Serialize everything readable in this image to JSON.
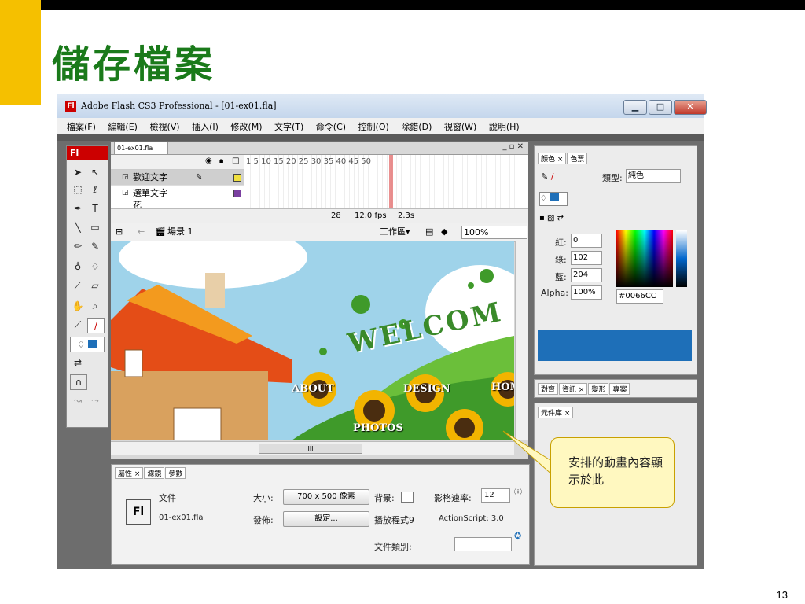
{
  "slide": {
    "title": "儲存檔案",
    "page_number": "13"
  },
  "window": {
    "title": "Adobe Flash CS3 Professional - [01-ex01.fla]",
    "min": "▁",
    "max": "□",
    "close": "✕"
  },
  "menu": [
    "檔案(F)",
    "編輯(E)",
    "檢視(V)",
    "插入(I)",
    "修改(M)",
    "文字(T)",
    "命令(C)",
    "控制(O)",
    "除錯(D)",
    "視窗(W)",
    "說明(H)"
  ],
  "tools": {
    "header": "Fl"
  },
  "document": {
    "tab": "01-ex01.fla",
    "controls": "_ ▫ ✕"
  },
  "timeline": {
    "frame_numbers": "1  5  10  15  20  25  30  35  40  45  50",
    "layers": [
      {
        "name": "歡迎文字",
        "color": "#f0e040"
      },
      {
        "name": "選單文字",
        "color": "#7a3fa0"
      },
      {
        "name": "花",
        "color": "#40a040"
      }
    ],
    "status": {
      "frame": "28",
      "fps": "12.0 fps",
      "time": "2.3s"
    }
  },
  "scene": {
    "name": "場景 1",
    "workspace": "工作區▾",
    "zoom": "100%"
  },
  "stage": {
    "welcome": "WELCOM",
    "nav": [
      "ABOUT",
      "DESIGN",
      "HOM",
      "PHOTOS"
    ],
    "hscroll_label": "III"
  },
  "properties": {
    "tabs": [
      "屬性 ×",
      "濾鏡",
      "參數"
    ],
    "doc_label": "文件",
    "doc_name": "01-ex01.fla",
    "size_label": "大小:",
    "size_value": "700 x 500 像素",
    "bg_label": "背景:",
    "fps_label": "影格速率:",
    "fps_value": "12",
    "publish_label": "發佈:",
    "settings_btn": "設定...",
    "player_label": "播放程式9",
    "actionscript": "ActionScript:  3.0",
    "class_label": "文件類別:",
    "fl_icon": "Fl"
  },
  "color_panel": {
    "tabs": [
      "顏色 ×",
      "色票"
    ],
    "type_label": "類型:",
    "type_value": "純色",
    "red_label": "紅:",
    "red_value": "0",
    "green_label": "綠:",
    "green_value": "102",
    "blue_label": "藍:",
    "blue_value": "204",
    "alpha_label": "Alpha:",
    "alpha_value": "100%",
    "hex_value": "#0066CC",
    "selected_color": "#1e6fb8"
  },
  "align_panel": {
    "tabs": [
      "對齊",
      "資訊 ×",
      "變形",
      "專案"
    ]
  },
  "library_panel": {
    "tabs": [
      "元件庫 ×"
    ]
  },
  "callout": {
    "text": "安排的動畫內容顯示於此"
  }
}
